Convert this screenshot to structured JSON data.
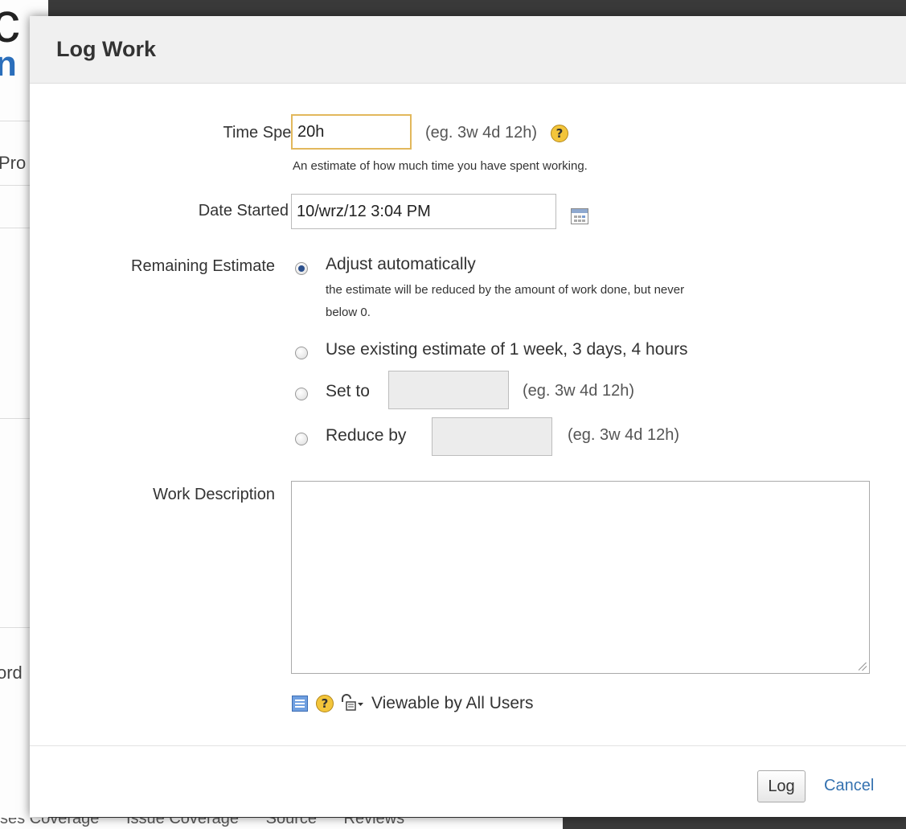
{
  "background": {
    "fragments": [
      "Pro",
      "ord"
    ],
    "bottom_tabs": [
      "ses Coverage",
      "Issue Coverage",
      "Source",
      "Reviews"
    ]
  },
  "dialog": {
    "title": "Log Work",
    "time_spent": {
      "label": "Time Spent",
      "required_mark": "*",
      "value": "20h",
      "hint": "(eg. 3w 4d 12h)",
      "description": "An estimate of how much time you have spent working."
    },
    "date_started": {
      "label": "Date Started",
      "required_mark": "*",
      "value": "10/wrz/12 3:04 PM",
      "calendar_icon": "calendar-icon"
    },
    "remaining_estimate": {
      "label": "Remaining Estimate",
      "selected": "adjust",
      "options": {
        "adjust": {
          "label": "Adjust automatically",
          "description_line1": "the estimate will be reduced by the amount of work done, but never",
          "description_line2": "below 0."
        },
        "existing": {
          "label": "Use existing estimate of 1 week, 3 days, 4 hours"
        },
        "set_to": {
          "label": "Set to",
          "value": "",
          "hint": "(eg. 3w 4d 12h)"
        },
        "reduce_by": {
          "label": "Reduce by",
          "value": "",
          "hint": "(eg. 3w 4d 12h)"
        }
      }
    },
    "work_description": {
      "label": "Work Description",
      "value": ""
    },
    "visibility": {
      "label": "Viewable by All Users",
      "icons": [
        "wiki-markup-icon",
        "help-icon",
        "lock-icon",
        "caret-down-icon"
      ]
    },
    "buttons": {
      "log": "Log",
      "cancel": "Cancel"
    }
  }
}
